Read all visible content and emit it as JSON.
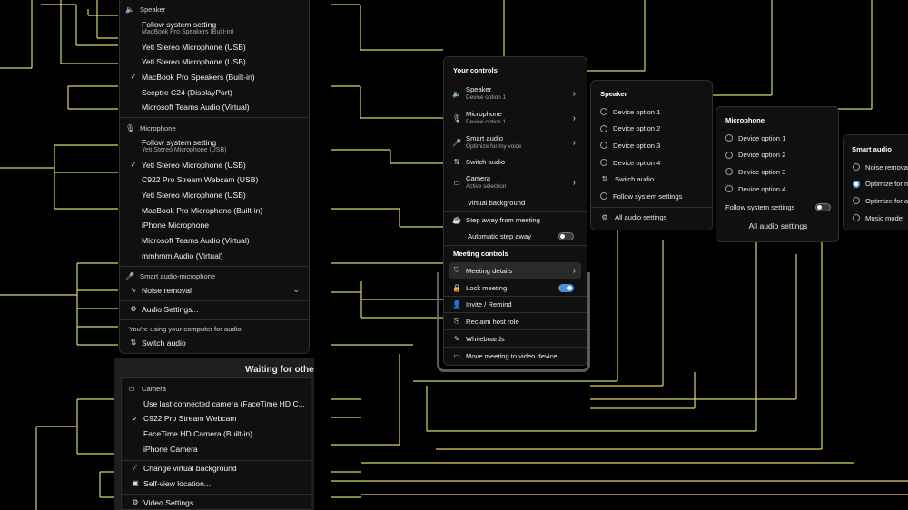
{
  "left_menu": {
    "speaker": {
      "title": "Speaker",
      "follow_label": "Follow system setting",
      "follow_sub": "MacBook Pro Speakers (Built-in)",
      "items": [
        {
          "label": "Yeti Stereo Microphone (USB)",
          "check": ""
        },
        {
          "label": "Yeti Stereo Microphone (USB)",
          "check": ""
        },
        {
          "label": "MacBook Pro Speakers (Built-in)",
          "check": "✓"
        },
        {
          "label": "Sceptre C24 (DisplayPort)",
          "check": ""
        },
        {
          "label": "Microsoft Teams Audio (Virtual)",
          "check": ""
        }
      ]
    },
    "microphone": {
      "title": "Microphone",
      "follow_label": "Follow system setting",
      "follow_sub": "Yeti Stereo Microphone (USB)",
      "items": [
        {
          "label": "Yeti Stereo Microphone (USB)",
          "check": "✓"
        },
        {
          "label": "C922 Pro Stream Webcam (USB)",
          "check": ""
        },
        {
          "label": "Yeti Stereo Microphone (USB)",
          "check": ""
        },
        {
          "label": "MacBook Pro Microphone (Built-in)",
          "check": ""
        },
        {
          "label": "iPhone Microphone",
          "check": ""
        },
        {
          "label": "Microsoft Teams Audio (Virtual)",
          "check": ""
        },
        {
          "label": "mmhmm Audio (Virtual)",
          "check": ""
        }
      ]
    },
    "smart_audio": {
      "title": "Smart audio-microphone",
      "noise_label": "Noise removal"
    },
    "audio_settings": "Audio Settings...",
    "computer_audio_note": "You're using your computer for audio",
    "switch_audio": "Switch audio"
  },
  "camera_menu": {
    "title": "Camera",
    "items": [
      {
        "label": "Use last connected camera (FaceTime HD C...",
        "check": ""
      },
      {
        "label": "C922 Pro Stream Webcam",
        "check": "✓"
      },
      {
        "label": "FaceTime HD Camera (Built-in)",
        "check": ""
      },
      {
        "label": "iPhone Camera",
        "check": ""
      }
    ],
    "change_bg": "Change virtual background",
    "self_view": "Self-view location...",
    "video_settings": "Video Settings..."
  },
  "waiting_text": "Waiting for othe",
  "controls": {
    "your_controls": "Your controls",
    "speaker": {
      "label": "Speaker",
      "sub": "Device option 1"
    },
    "microphone": {
      "label": "Microphone",
      "sub": "Device option 1"
    },
    "smart_audio": {
      "label": "Smart audio",
      "sub": "Optimize for my voice"
    },
    "switch_audio": "Switch audio",
    "camera": {
      "label": "Camera",
      "sub": "Active selection"
    },
    "virtual_bg": "Virtual background",
    "step_away": "Step away from meeting",
    "auto_step_away": "Automatic step away",
    "auto_step_away_on": false,
    "meeting_controls": "Meeting controls",
    "meeting_details": "Meeting details",
    "lock_meeting": "Lock meeting",
    "lock_meeting_on": true,
    "invite": "Invite / Remind",
    "reclaim": "Reclaim host role",
    "whiteboards": "Whiteboards",
    "move_meeting": "Move meeting to video device"
  },
  "speaker_panel": {
    "title": "Speaker",
    "options": [
      "Device option 1",
      "Device option 2",
      "Device option 3",
      "Device option 4"
    ],
    "switch_audio": "Switch audio",
    "follow_system": "Follow system settings",
    "all_settings": "All audio settings"
  },
  "microphone_panel": {
    "title": "Microphone",
    "options": [
      "Device option 1",
      "Device option 2",
      "Device option 3",
      "Device option 4"
    ],
    "follow_system": "Follow system settings",
    "follow_on": false,
    "all_settings": "All audio settings"
  },
  "smart_audio_panel": {
    "title": "Smart audio",
    "options": [
      "Noise removal",
      "Optimize for m",
      "Optimize for al",
      "Music mode"
    ],
    "selected_index": 1
  },
  "colors": {
    "connector": "#ddd26a",
    "accent": "#4a90d9"
  }
}
